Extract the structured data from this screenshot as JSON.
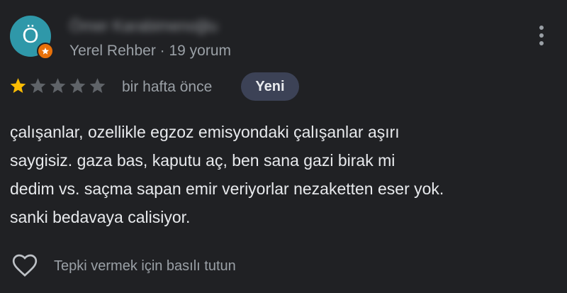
{
  "reviewer": {
    "avatar_letter": "Ö",
    "name": "Ömer Karabimenoğlu",
    "meta": "Yerel Rehber · 19 yorum",
    "avatar_color": "#2f98a9",
    "badge_color": "#e8710a"
  },
  "rating": {
    "stars": 1,
    "max_stars": 5,
    "star_filled_color": "#fbbc04",
    "star_empty_color": "#5f6368",
    "time": "bir hafta önce",
    "badge": "Yeni"
  },
  "review": {
    "lines": [
      "çalışanlar, ozellikle egzoz emisyondaki çalışanlar aşırı",
      "saygisiz. gaza bas, kaputu aç, ben sana gazi birak mi",
      "dedim vs. saçma sapan emir veriyorlar nezaketten eser yok.",
      "sanki bedavaya calisiyor."
    ]
  },
  "footer": {
    "react_hint": "Tepki vermek için basılı tutun"
  },
  "icons": {
    "menu": "more-vert-icon",
    "reaction": "heart-outline-icon",
    "guide": "local-guide-star-icon"
  }
}
